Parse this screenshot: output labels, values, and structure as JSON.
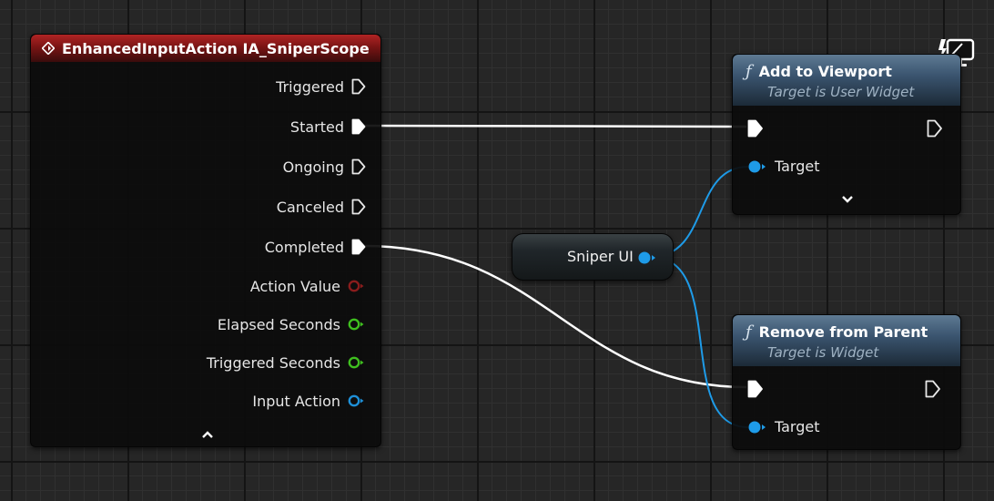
{
  "event_node": {
    "title": "EnhancedInputAction IA_SniperScope",
    "header_color": "#9e1f1f",
    "pins": [
      {
        "label": "Triggered",
        "type": "exec",
        "connected": false
      },
      {
        "label": "Started",
        "type": "exec",
        "connected": true
      },
      {
        "label": "Ongoing",
        "type": "exec",
        "connected": false
      },
      {
        "label": "Canceled",
        "type": "exec",
        "connected": false
      },
      {
        "label": "Completed",
        "type": "exec",
        "connected": true
      },
      {
        "label": "Action Value",
        "type": "data",
        "color": "#8a1c1c"
      },
      {
        "label": "Elapsed Seconds",
        "type": "data",
        "color": "#3fbf1f"
      },
      {
        "label": "Triggered Seconds",
        "type": "data",
        "color": "#3fbf1f"
      },
      {
        "label": "Input Action",
        "type": "data",
        "color": "#1e90d8"
      }
    ],
    "collapse_icon": "chevron-up-icon"
  },
  "add_to_viewport": {
    "title": "Add to Viewport",
    "subtitle": "Target is User Widget",
    "target_label": "Target",
    "expand_icon": "chevron-down-icon"
  },
  "remove_from_parent": {
    "title": "Remove from Parent",
    "subtitle": "Target is Widget",
    "target_label": "Target"
  },
  "variable_node": {
    "label": "Sniper UI",
    "pin_color": "#1e9be8"
  },
  "colors": {
    "exec_wire": "#ffffff",
    "object_wire": "#1e9be8",
    "func_header": "#3b5570"
  },
  "icons": {
    "event": "event-diamond-icon",
    "function": "function-icon",
    "widget_context": "monitor-lightning-icon"
  }
}
